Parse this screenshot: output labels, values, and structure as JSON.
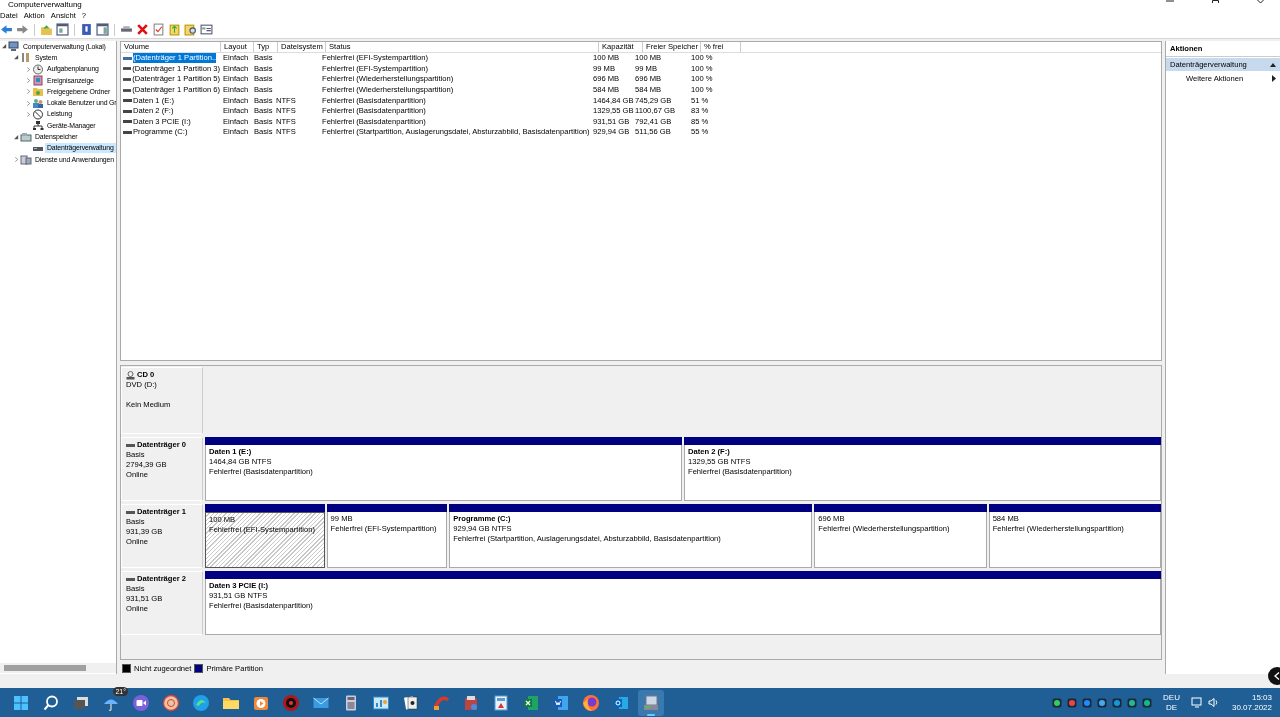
{
  "window": {
    "title": "Computerverwaltung"
  },
  "menu": [
    "Datei",
    "Aktion",
    "Ansicht",
    "?"
  ],
  "tree": [
    {
      "label": "Computerverwaltung (Lokal)",
      "kind": "computer",
      "expanded": true,
      "selected": false,
      "children": [
        {
          "label": "System",
          "kind": "tools",
          "expanded": true,
          "selected": false,
          "children": [
            {
              "label": "Aufgabenplanung",
              "kind": "clock",
              "expanded": false,
              "selected": false
            },
            {
              "label": "Ereignisanzeige",
              "kind": "log",
              "expanded": false,
              "selected": false
            },
            {
              "label": "Freigegebene Ordner",
              "kind": "folder",
              "expanded": false,
              "selected": false
            },
            {
              "label": "Lokale Benutzer und Gr",
              "kind": "users",
              "expanded": false,
              "selected": false
            },
            {
              "label": "Leistung",
              "kind": "gauge",
              "expanded": false,
              "selected": false
            },
            {
              "label": "Geräte-Manager",
              "kind": "device",
              "selected": false
            }
          ]
        },
        {
          "label": "Datenspeicher",
          "kind": "storage",
          "expanded": true,
          "selected": false,
          "children": [
            {
              "label": "Datenträgerverwaltung",
              "kind": "disk",
              "selected": true
            }
          ]
        },
        {
          "label": "Dienste und Anwendungen",
          "kind": "services",
          "expanded": false,
          "selected": false
        }
      ]
    }
  ],
  "volumes": {
    "columns": [
      "Volume",
      "Layout",
      "Typ",
      "Dateisystem",
      "Status",
      "Kapazität",
      "Freier Speicher",
      "% frei"
    ],
    "rows": [
      {
        "selected": true,
        "cells": [
          "(Datenträger 1 Partition..",
          "Einfach",
          "Basis",
          "",
          "Fehlerfrei (EFI-Systempartition)",
          "100 MB",
          "100 MB",
          "100 %"
        ]
      },
      {
        "selected": false,
        "cells": [
          "(Datenträger 1 Partition 3)",
          "Einfach",
          "Basis",
          "",
          "Fehlerfrei (EFI-Systempartition)",
          "99 MB",
          "99 MB",
          "100 %"
        ]
      },
      {
        "selected": false,
        "cells": [
          "(Datenträger 1 Partition 5)",
          "Einfach",
          "Basis",
          "",
          "Fehlerfrei (Wiederherstellungspartition)",
          "696 MB",
          "696 MB",
          "100 %"
        ]
      },
      {
        "selected": false,
        "cells": [
          "(Datenträger 1 Partition 6)",
          "Einfach",
          "Basis",
          "",
          "Fehlerfrei (Wiederherstellungspartition)",
          "584 MB",
          "584 MB",
          "100 %"
        ]
      },
      {
        "selected": false,
        "cells": [
          "Daten 1 (E:)",
          "Einfach",
          "Basis",
          "NTFS",
          "Fehlerfrei (Basisdatenpartition)",
          "1464,84 GB",
          "745,29 GB",
          "51 %"
        ]
      },
      {
        "selected": false,
        "cells": [
          "Daten 2 (F:)",
          "Einfach",
          "Basis",
          "NTFS",
          "Fehlerfrei (Basisdatenpartition)",
          "1329,55 GB",
          "1100,67 GB",
          "83 %"
        ]
      },
      {
        "selected": false,
        "cells": [
          "Daten 3   PCIE (I:)",
          "Einfach",
          "Basis",
          "NTFS",
          "Fehlerfrei (Basisdatenpartition)",
          "931,51 GB",
          "792,41 GB",
          "85 %"
        ]
      },
      {
        "selected": false,
        "cells": [
          "Programme (C:)",
          "Einfach",
          "Basis",
          "NTFS",
          "Fehlerfrei (Startpartition, Auslagerungsdatei, Absturzabbild, Basisdatenpartition)",
          "929,94 GB",
          "511,56 GB",
          "55 %"
        ]
      }
    ]
  },
  "disks": [
    {
      "kind": "cdrom",
      "name": "CD 0",
      "type": "DVD (D:)",
      "status": "Kein Medium"
    },
    {
      "kind": "disk",
      "name": "Datenträger 0",
      "type": "Basis",
      "size": "2794,39 GB",
      "status": "Online",
      "partitions": [
        {
          "title": "Daten 1  (E:)",
          "size": "1464,84 GB NTFS",
          "status": "Fehlerfrei (Basisdatenpartition)",
          "selected": false
        },
        {
          "title": "Daten 2  (F:)",
          "size": "1329,55 GB NTFS",
          "status": "Fehlerfrei (Basisdatenpartition)",
          "selected": false
        }
      ]
    },
    {
      "kind": "disk",
      "name": "Datenträger 1",
      "type": "Basis",
      "size": "931,39 GB",
      "status": "Online",
      "partitions": [
        {
          "size": "100 MB",
          "status": "Fehlerfrei (EFI-Systempartition)",
          "selected": true
        },
        {
          "size": "99 MB",
          "status": "Fehlerfrei (EFI-Systempartition)",
          "selected": false
        },
        {
          "title": "Programme  (C:)",
          "size": "929,94 GB NTFS",
          "status": "Fehlerfrei (Startpartition, Auslagerungsdatei, Absturzabbild, Basisdatenpartition)",
          "selected": false
        },
        {
          "size": "696 MB",
          "status": "Fehlerfrei (Wiederherstellungspartition)",
          "selected": false
        },
        {
          "size": "584 MB",
          "status": "Fehlerfrei (Wiederherstellungspartition)",
          "selected": false
        }
      ]
    },
    {
      "kind": "disk",
      "name": "Datenträger 2",
      "type": "Basis",
      "size": "931,51 GB",
      "status": "Online",
      "partitions": [
        {
          "title": "Daten 3   PCIE  (I:)",
          "size": "931,51 GB NTFS",
          "status": "Fehlerfrei (Basisdatenpartition)",
          "selected": false
        }
      ]
    }
  ],
  "legend": [
    {
      "label": "Nicht zugeordnet",
      "color": "#000000"
    },
    {
      "label": "Primäre Partition",
      "color": "#000080"
    }
  ],
  "actions": {
    "title": "Aktionen",
    "section": "Datenträgerverwaltung",
    "items": [
      "Weitere Aktionen"
    ]
  },
  "taskbar": {
    "apps": [
      {
        "kind": "windows",
        "selected": false
      },
      {
        "kind": "search",
        "selected": false
      },
      {
        "kind": "stack",
        "selected": false
      },
      {
        "kind": "weather",
        "badge": "21°",
        "selected": false
      },
      {
        "kind": "video",
        "selected": false
      },
      {
        "kind": "globe",
        "selected": false
      },
      {
        "kind": "swirl",
        "selected": false
      },
      {
        "kind": "folder",
        "selected": false
      },
      {
        "kind": "play",
        "selected": false
      },
      {
        "kind": "target",
        "selected": false
      },
      {
        "kind": "envelope",
        "selected": false
      },
      {
        "kind": "calculator",
        "selected": false
      },
      {
        "kind": "chart",
        "selected": false
      },
      {
        "kind": "cards",
        "selected": false
      },
      {
        "kind": "brush",
        "selected": false
      },
      {
        "kind": "box",
        "selected": false
      },
      {
        "kind": "badge",
        "selected": false
      },
      {
        "kind": "sheet",
        "selected": false
      },
      {
        "kind": "document",
        "selected": false
      },
      {
        "kind": "fox",
        "selected": false
      },
      {
        "kind": "mailtile",
        "selected": false
      },
      {
        "kind": "drive",
        "selected": true
      }
    ],
    "language": [
      "DEU",
      "DE"
    ],
    "time": "15:03",
    "date": "30.07.2022"
  }
}
